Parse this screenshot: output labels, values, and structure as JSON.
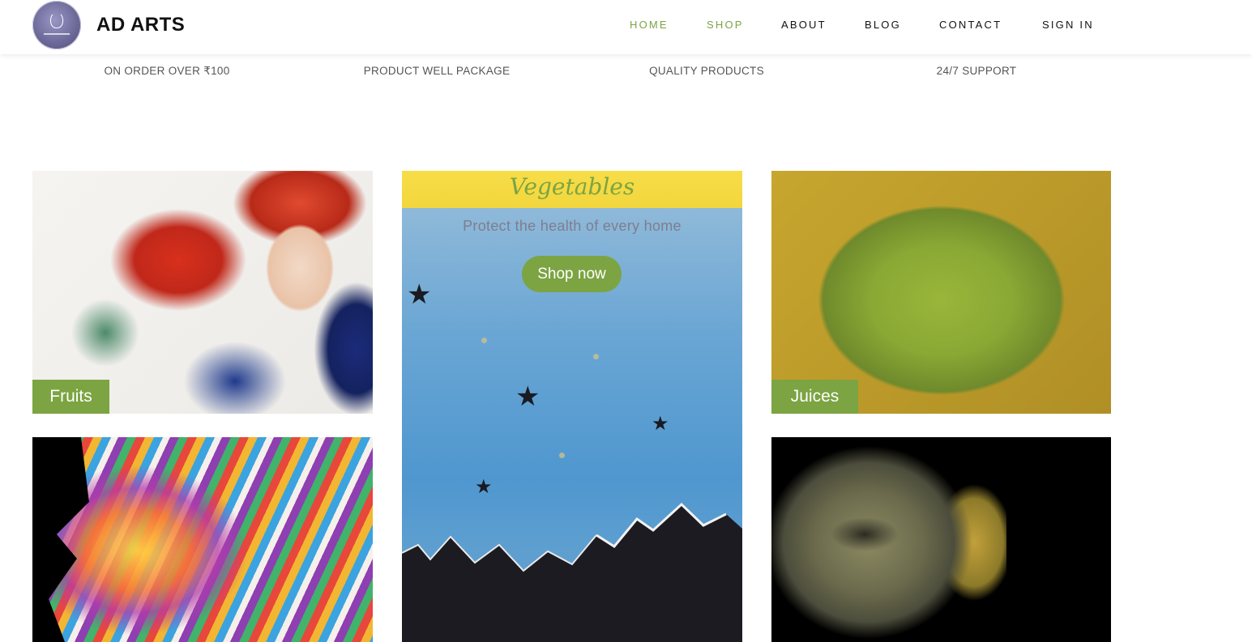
{
  "header": {
    "brand": "AD ARTS",
    "nav": [
      "HOME",
      "SHOP",
      "ABOUT",
      "BLOG",
      "CONTACT",
      "SIGN IN"
    ],
    "active_color": "#7ca442"
  },
  "features": [
    "ON ORDER OVER ₹100",
    "PRODUCT WELL PACKAGE",
    "QUALITY PRODUCTS",
    "24/7 SUPPORT"
  ],
  "tiles": {
    "featured": {
      "title": "Vegetables",
      "subtitle": "Protect the health of every home",
      "button": "Shop now"
    },
    "fruits_label": "Fruits",
    "juices_label": "Juices"
  },
  "colors": {
    "accent": "#7ca442",
    "text": "#111111"
  }
}
